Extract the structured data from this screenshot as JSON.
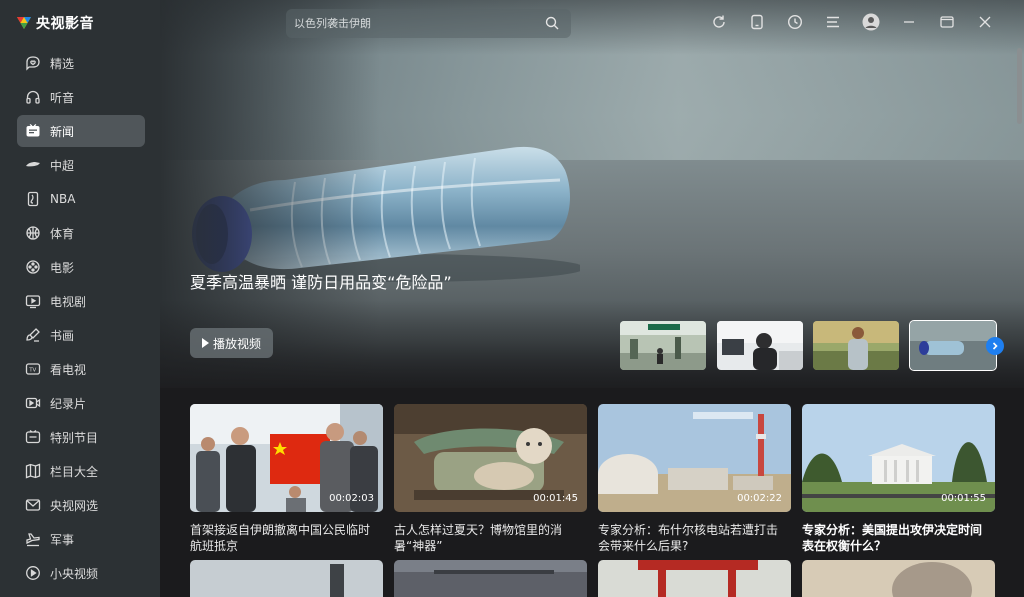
{
  "app": {
    "name": "央视影音",
    "accent": "#1e7ff0"
  },
  "sidebar": {
    "items": [
      {
        "label": "精选",
        "icon": "heart-chat-icon",
        "active": false
      },
      {
        "label": "听音",
        "icon": "headphones-icon",
        "active": false
      },
      {
        "label": "新闻",
        "icon": "news-icon",
        "active": true
      },
      {
        "label": "中超",
        "icon": "football-icon",
        "active": false
      },
      {
        "label": "NBA",
        "icon": "nba-icon",
        "active": false
      },
      {
        "label": "体育",
        "icon": "basketball-icon",
        "active": false
      },
      {
        "label": "电影",
        "icon": "film-reel-icon",
        "active": false
      },
      {
        "label": "电视剧",
        "icon": "tv-series-icon",
        "active": false
      },
      {
        "label": "书画",
        "icon": "brush-icon",
        "active": false
      },
      {
        "label": "看电视",
        "icon": "tv-icon",
        "active": false
      },
      {
        "label": "纪录片",
        "icon": "documentary-icon",
        "active": false
      },
      {
        "label": "特别节目",
        "icon": "special-program-icon",
        "active": false
      },
      {
        "label": "栏目大全",
        "icon": "columns-icon",
        "active": false
      },
      {
        "label": "央视网选",
        "icon": "mail-icon",
        "active": false
      },
      {
        "label": "军事",
        "icon": "military-icon",
        "active": false
      },
      {
        "label": "小央视频",
        "icon": "play-circle-icon",
        "active": false
      }
    ]
  },
  "search": {
    "placeholder": "以色列袭击伊朗"
  },
  "hero": {
    "title": "夏季高温暴晒 谨防日用品变“危险品”",
    "play_label": "播放视频"
  },
  "cards": [
    {
      "title": "首架接返自伊朗撤离中国公民临时航班抵京",
      "duration": "00:02:03",
      "bold": false
    },
    {
      "title": "古人怎样过夏天？博物馆里的消暑“神器”",
      "duration": "00:01:45",
      "bold": false
    },
    {
      "title": "专家分析：布什尔核电站若遭打击会带来什么后果?",
      "duration": "00:02:22",
      "bold": false
    },
    {
      "title": "专家分析：美国提出攻伊决定时间表在权衡什么？",
      "duration": "00:01:55",
      "bold": true
    }
  ]
}
